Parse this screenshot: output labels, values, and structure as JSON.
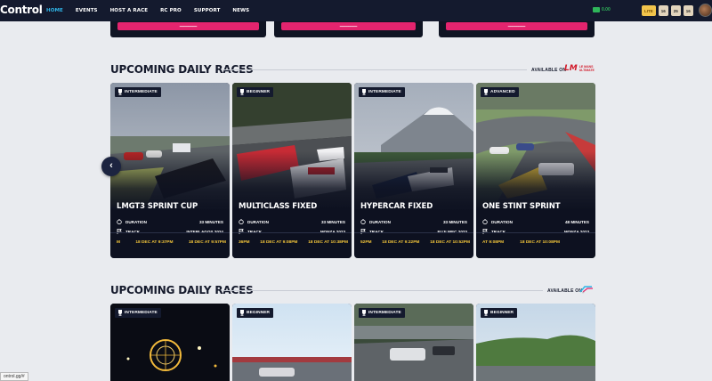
{
  "nav": {
    "brand": "Control",
    "links": [
      {
        "label": "HOME",
        "active": true
      },
      {
        "label": "EVENTS",
        "active": false
      },
      {
        "label": "HOST A RACE",
        "active": false
      },
      {
        "label": "RC PRO",
        "active": false
      },
      {
        "label": "SUPPORT",
        "active": false
      },
      {
        "label": "NEWS",
        "active": false
      }
    ],
    "wallet": "0.00",
    "pills": [
      "LITE",
      "16",
      "25",
      "16"
    ],
    "accent": "#2fb6e8"
  },
  "sections": [
    {
      "title": "UPCOMING DAILY RACES",
      "available_on": "AVAILABLE ON",
      "platform_logo": "LM",
      "platform_logo_sub": "LE MANS ULTIMATE",
      "cards": [
        {
          "level": "INTERMEDIATE",
          "title": "LMGT3 SPRINT CUP",
          "duration_label": "DURATION",
          "duration": "33 MINUTES",
          "track_label": "TRACK",
          "track": "INTERLAGOS 2024",
          "times": [
            "M",
            "18 DEC AT 9:37PM",
            "18 DEC AT 9:57PM"
          ]
        },
        {
          "level": "BEGINNER",
          "title": "MULTICLASS FIXED",
          "duration_label": "DURATION",
          "duration": "33 MINUTES",
          "track_label": "TRACK",
          "track": "MONZA 2023",
          "times": [
            "36PM",
            "18 DEC AT 9:08PM",
            "18 DEC AT 10:38PM"
          ]
        },
        {
          "level": "INTERMEDIATE",
          "title": "HYPERCAR FIXED",
          "duration_label": "DURATION",
          "duration": "33 MINUTES",
          "track_label": "TRACK",
          "track": "FUJI WEC 2023",
          "times": [
            "52PM",
            "18 DEC AT 9:22PM",
            "18 DEC AT 10:52PM"
          ]
        },
        {
          "level": "ADVANCED",
          "title": "ONE STINT SPRINT",
          "duration_label": "DURATION",
          "duration": "48 MINUTES",
          "track_label": "TRACK",
          "track": "MONZA 2023",
          "times": [
            "AT 9:08PM",
            "18 DEC AT 10:08PM"
          ]
        }
      ]
    },
    {
      "title": "UPCOMING DAILY RACES",
      "available_on": "AVAILABLE ON",
      "platform_logo": "rF",
      "cards": [
        {
          "level": "INTERMEDIATE"
        },
        {
          "level": "BEGINNER"
        },
        {
          "level": "INTERMEDIATE"
        },
        {
          "level": "BEGINNER"
        }
      ]
    }
  ],
  "status_url": "ontrol.gg/#",
  "colors": {
    "time_yellow": "#f4c63a",
    "card_bg": "#0d1120",
    "pink": "#e3246e"
  },
  "icons": {
    "prev_arrow": "chevron-left-icon",
    "badge": "trophy-icon",
    "duration": "stopwatch-icon",
    "track": "flag-icon"
  }
}
